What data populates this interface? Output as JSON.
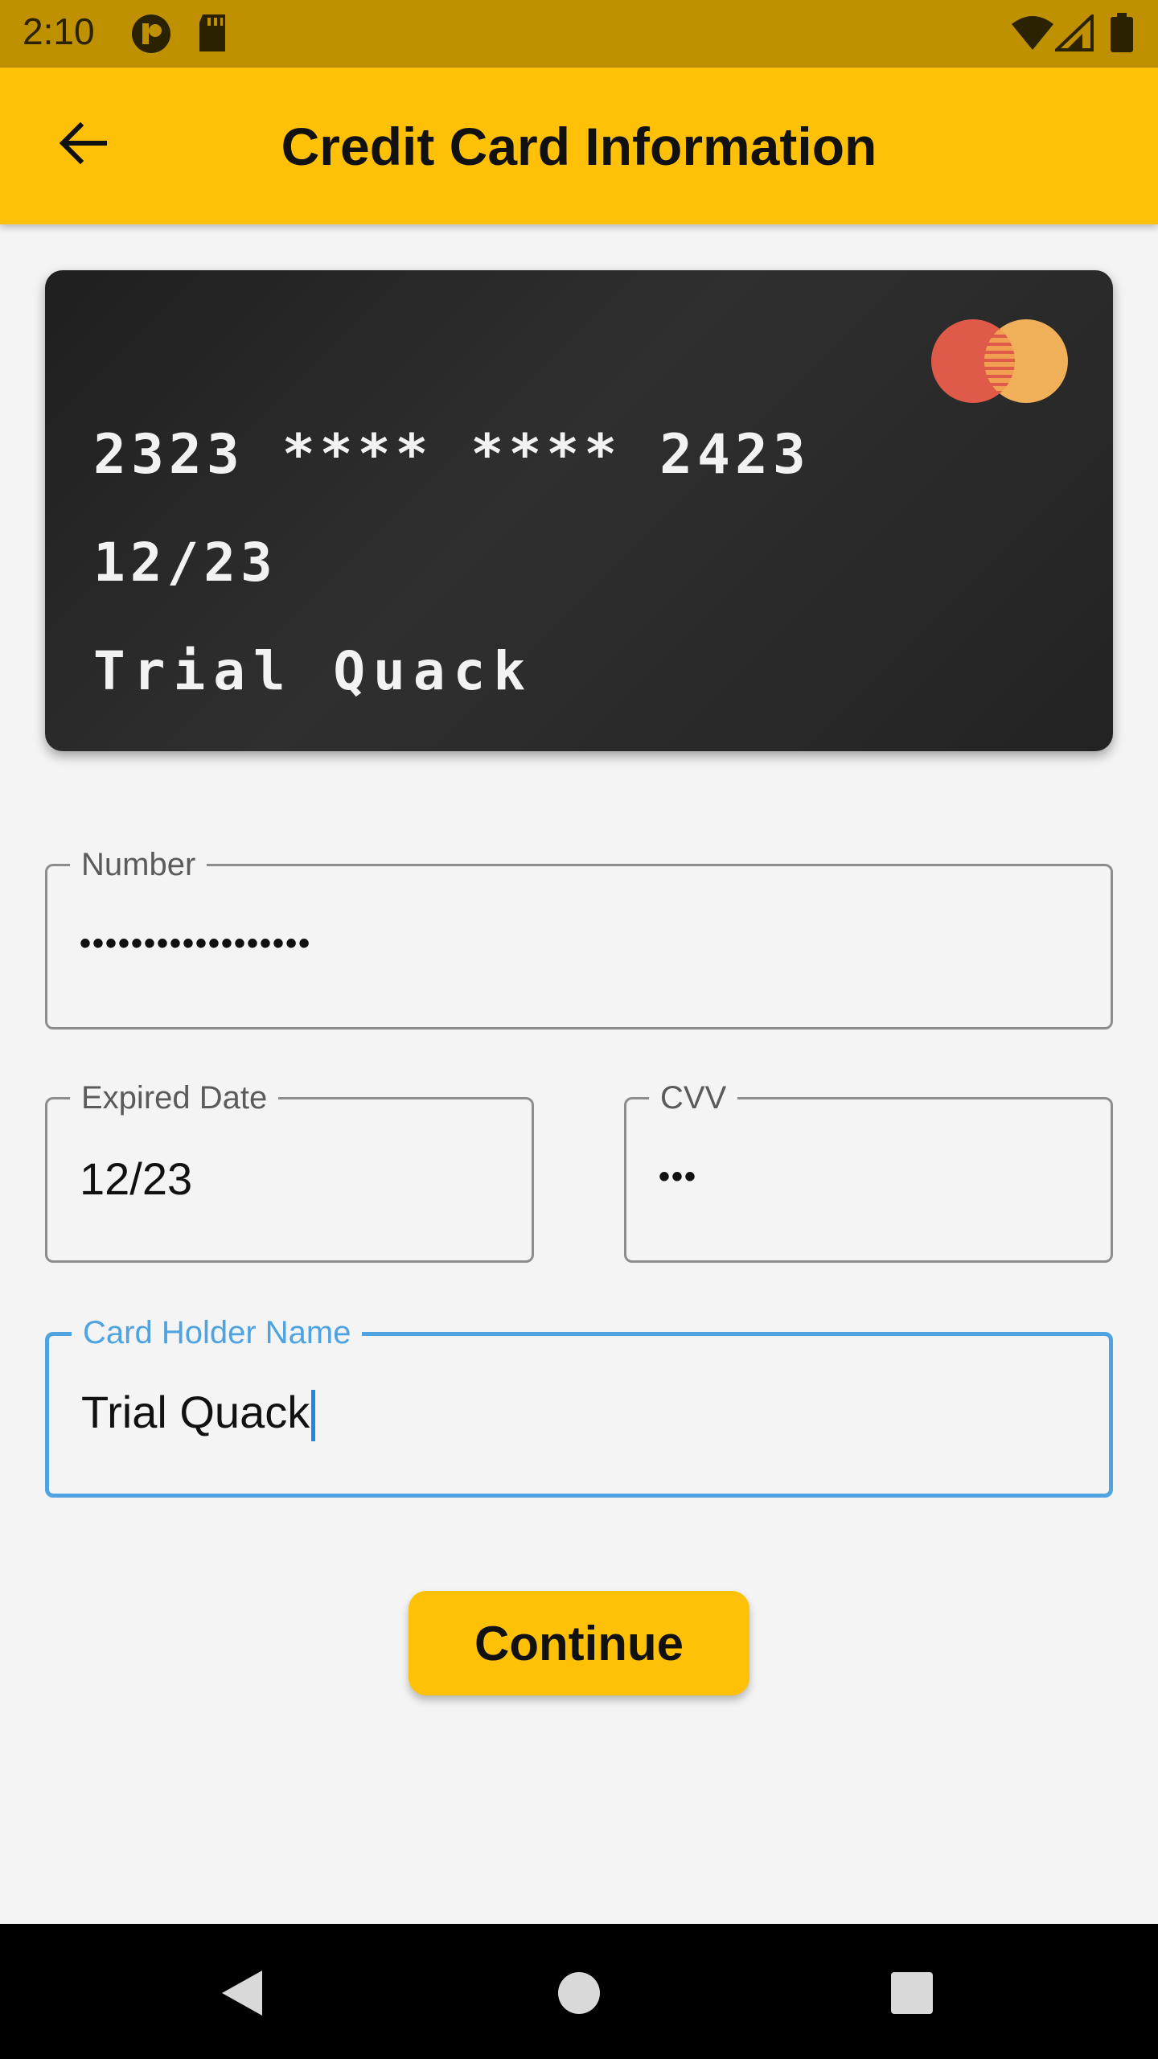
{
  "status_bar": {
    "time": "2:10",
    "icons": [
      "clock-app-icon",
      "sd-card-icon",
      "wifi-icon",
      "signal-icon",
      "battery-icon"
    ]
  },
  "app_bar": {
    "title": "Credit Card Information",
    "back_icon": "arrow-back-icon"
  },
  "card": {
    "number": "2323 **** **** 2423",
    "expiry": "12/23",
    "holder": "Trial Quack",
    "brand_icon": "mastercard-logo-icon"
  },
  "form": {
    "number": {
      "label": "Number",
      "value": "••••••••••••••••••"
    },
    "expired_date": {
      "label": "Expired Date",
      "value": "12/23"
    },
    "cvv": {
      "label": "CVV",
      "value": "•••"
    },
    "card_holder": {
      "label": "Card Holder Name",
      "value": "Trial Quack"
    }
  },
  "actions": {
    "continue_label": "Continue"
  },
  "nav_bar": {
    "icons": [
      "back-triangle-icon",
      "home-circle-icon",
      "recents-square-icon"
    ]
  },
  "colors": {
    "status_bar": "#bf9000",
    "app_bar": "#ffc107",
    "card_bg": "#262626",
    "focus": "#4ea3e0",
    "button": "#ffc107"
  }
}
